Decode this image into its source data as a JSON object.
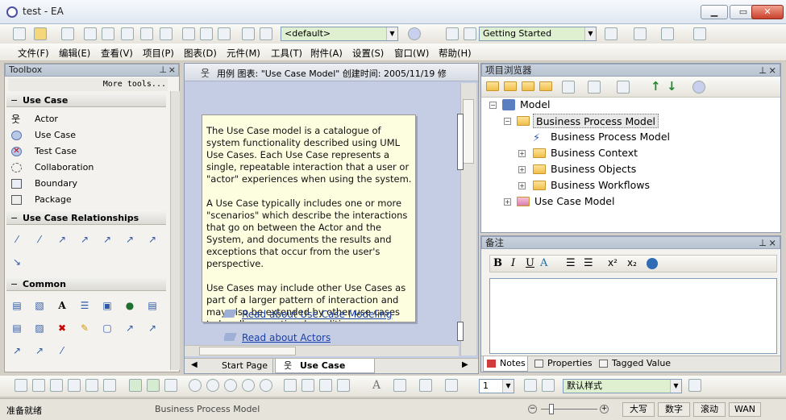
{
  "window": {
    "title": "test - EA"
  },
  "toolbar1": {
    "default_combo": "<default>",
    "perspective_combo": "Getting Started"
  },
  "menu": [
    "文件(F)",
    "编辑(E)",
    "查看(V)",
    "项目(P)",
    "图表(D)",
    "元件(M)",
    "工具(T)",
    "附件(A)",
    "设置(S)",
    "窗口(W)",
    "帮助(H)"
  ],
  "toolbox": {
    "header": "Toolbox",
    "more_tools": "More tools...",
    "sections": {
      "use_case": "Use Case",
      "relationships": "Use Case Relationships",
      "common": "Common"
    },
    "use_case_items": [
      "Actor",
      "Use Case",
      "Test Case",
      "Collaboration",
      "Boundary",
      "Package"
    ]
  },
  "diagram": {
    "title": "用例 图表: \"Use Case Model\"  创建时间: 2005/11/19  修",
    "note": "The Use Case model is a catalogue of system functionality described using UML Use Cases. Each Use Case represents a single, repeatable interaction that a user or \"actor\" experiences when using the system.\n\nA Use Case typically includes one or more \"scenarios\" which describe the interactions that go on between the Actor and the System, and documents the results and exceptions that occur from the user's perspective.\n\nUse Cases may include other Use Cases as part of a larger pattern of interaction and may also be extended by other use cases to handle exceptional conditions.",
    "link1": "Read about Use Case Modeling",
    "link2": "Read about Actors",
    "tab_start": "Start Page",
    "tab_model": "Use Case Model"
  },
  "project_browser": {
    "header": "项目浏览器",
    "root": "Model",
    "bpm": "Business Process Model",
    "bpm_child": "Business Process Model",
    "context": "Business Context",
    "objects": "Business Objects",
    "workflows": "Business Workflows",
    "ucm": "Use Case Model"
  },
  "notes": {
    "header": "备注",
    "tab_notes": "Notes",
    "tab_properties": "Properties",
    "tab_tagged": "Tagged Value"
  },
  "bottom_toolbar": {
    "zoom": "1",
    "style": "默认样式"
  },
  "status": {
    "left": "准备就绪",
    "element": "Business Process Model",
    "caps": "大写",
    "num": "数字",
    "scroll": "滚动",
    "wan": "WAN"
  },
  "colors": {
    "diagram_bg": "#c4cde4",
    "note_bg": "#fdfde0",
    "combo_green": "#dff0d0",
    "link": "#1a3fa8"
  }
}
